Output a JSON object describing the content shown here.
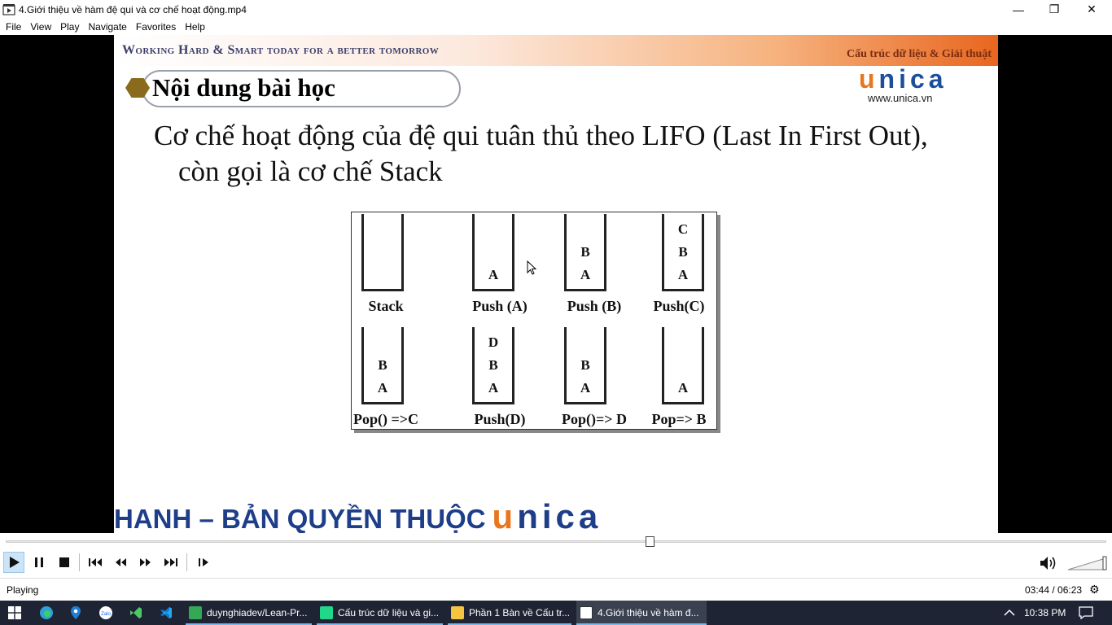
{
  "window": {
    "title": "4.Giới thiệu về hàm đệ qui và cơ chế hoạt động.mp4",
    "minimize": "—",
    "maximize": "❐",
    "close": "✕"
  },
  "menu": [
    "File",
    "View",
    "Play",
    "Navigate",
    "Favorites",
    "Help"
  ],
  "slide": {
    "motto": "Working Hard & Smart today for a better tomorrow",
    "course": "Cấu trúc dữ liệu & Giải thuật",
    "logo_u": "u",
    "logo_rest": "nica",
    "logo_url": "www.unica.vn",
    "lesson_title": "Nội dung bài học",
    "body_line1": "Cơ chế hoạt động của đệ qui tuân thủ theo LIFO (Last In First Out),",
    "body_line2": "còn gọi là cơ chế Stack",
    "watermark_text": "HANH – BẢN QUYỀN THUỘC",
    "watermark_logo_u": "u",
    "watermark_logo_rest": "nica"
  },
  "stacks": [
    {
      "caption": "Stack",
      "items": []
    },
    {
      "caption": "Push (A)",
      "items": [
        "A"
      ]
    },
    {
      "caption": "Push (B)",
      "items": [
        "B",
        "A"
      ]
    },
    {
      "caption": "Push(C)",
      "items": [
        "C",
        "B",
        "A"
      ]
    },
    {
      "caption": "Pop() =>C",
      "items": [
        "B",
        "A"
      ]
    },
    {
      "caption": "Push(D)",
      "items": [
        "D",
        "B",
        "A"
      ]
    },
    {
      "caption": "Pop()=> D",
      "items": [
        "B",
        "A"
      ]
    },
    {
      "caption": "Pop=> B",
      "items": [
        "A"
      ]
    }
  ],
  "player": {
    "position_seconds": 224,
    "duration_seconds": 383,
    "status": "Playing",
    "time": "03:44 / 06:23",
    "colors": {
      "accent": "#cce4f7",
      "logo_blue": "#1a4f9c",
      "logo_orange": "#e8761f"
    }
  },
  "taskbar": {
    "apps": [
      {
        "label": "duynghiadev/Lean-Pr...",
        "icon": "chrome-icon",
        "color": "#34a853"
      },
      {
        "label": "Cấu trúc dữ liệu và gi...",
        "icon": "pycharm-icon",
        "color": "#21d789"
      },
      {
        "label": "Phần 1 Bàn về Cấu tr...",
        "icon": "notes-icon",
        "color": "#f5c542"
      },
      {
        "label": "4.Giới thiệu về hàm đ...",
        "icon": "media-player-icon",
        "color": "#ffffff"
      }
    ],
    "clock": "10:38 PM"
  }
}
